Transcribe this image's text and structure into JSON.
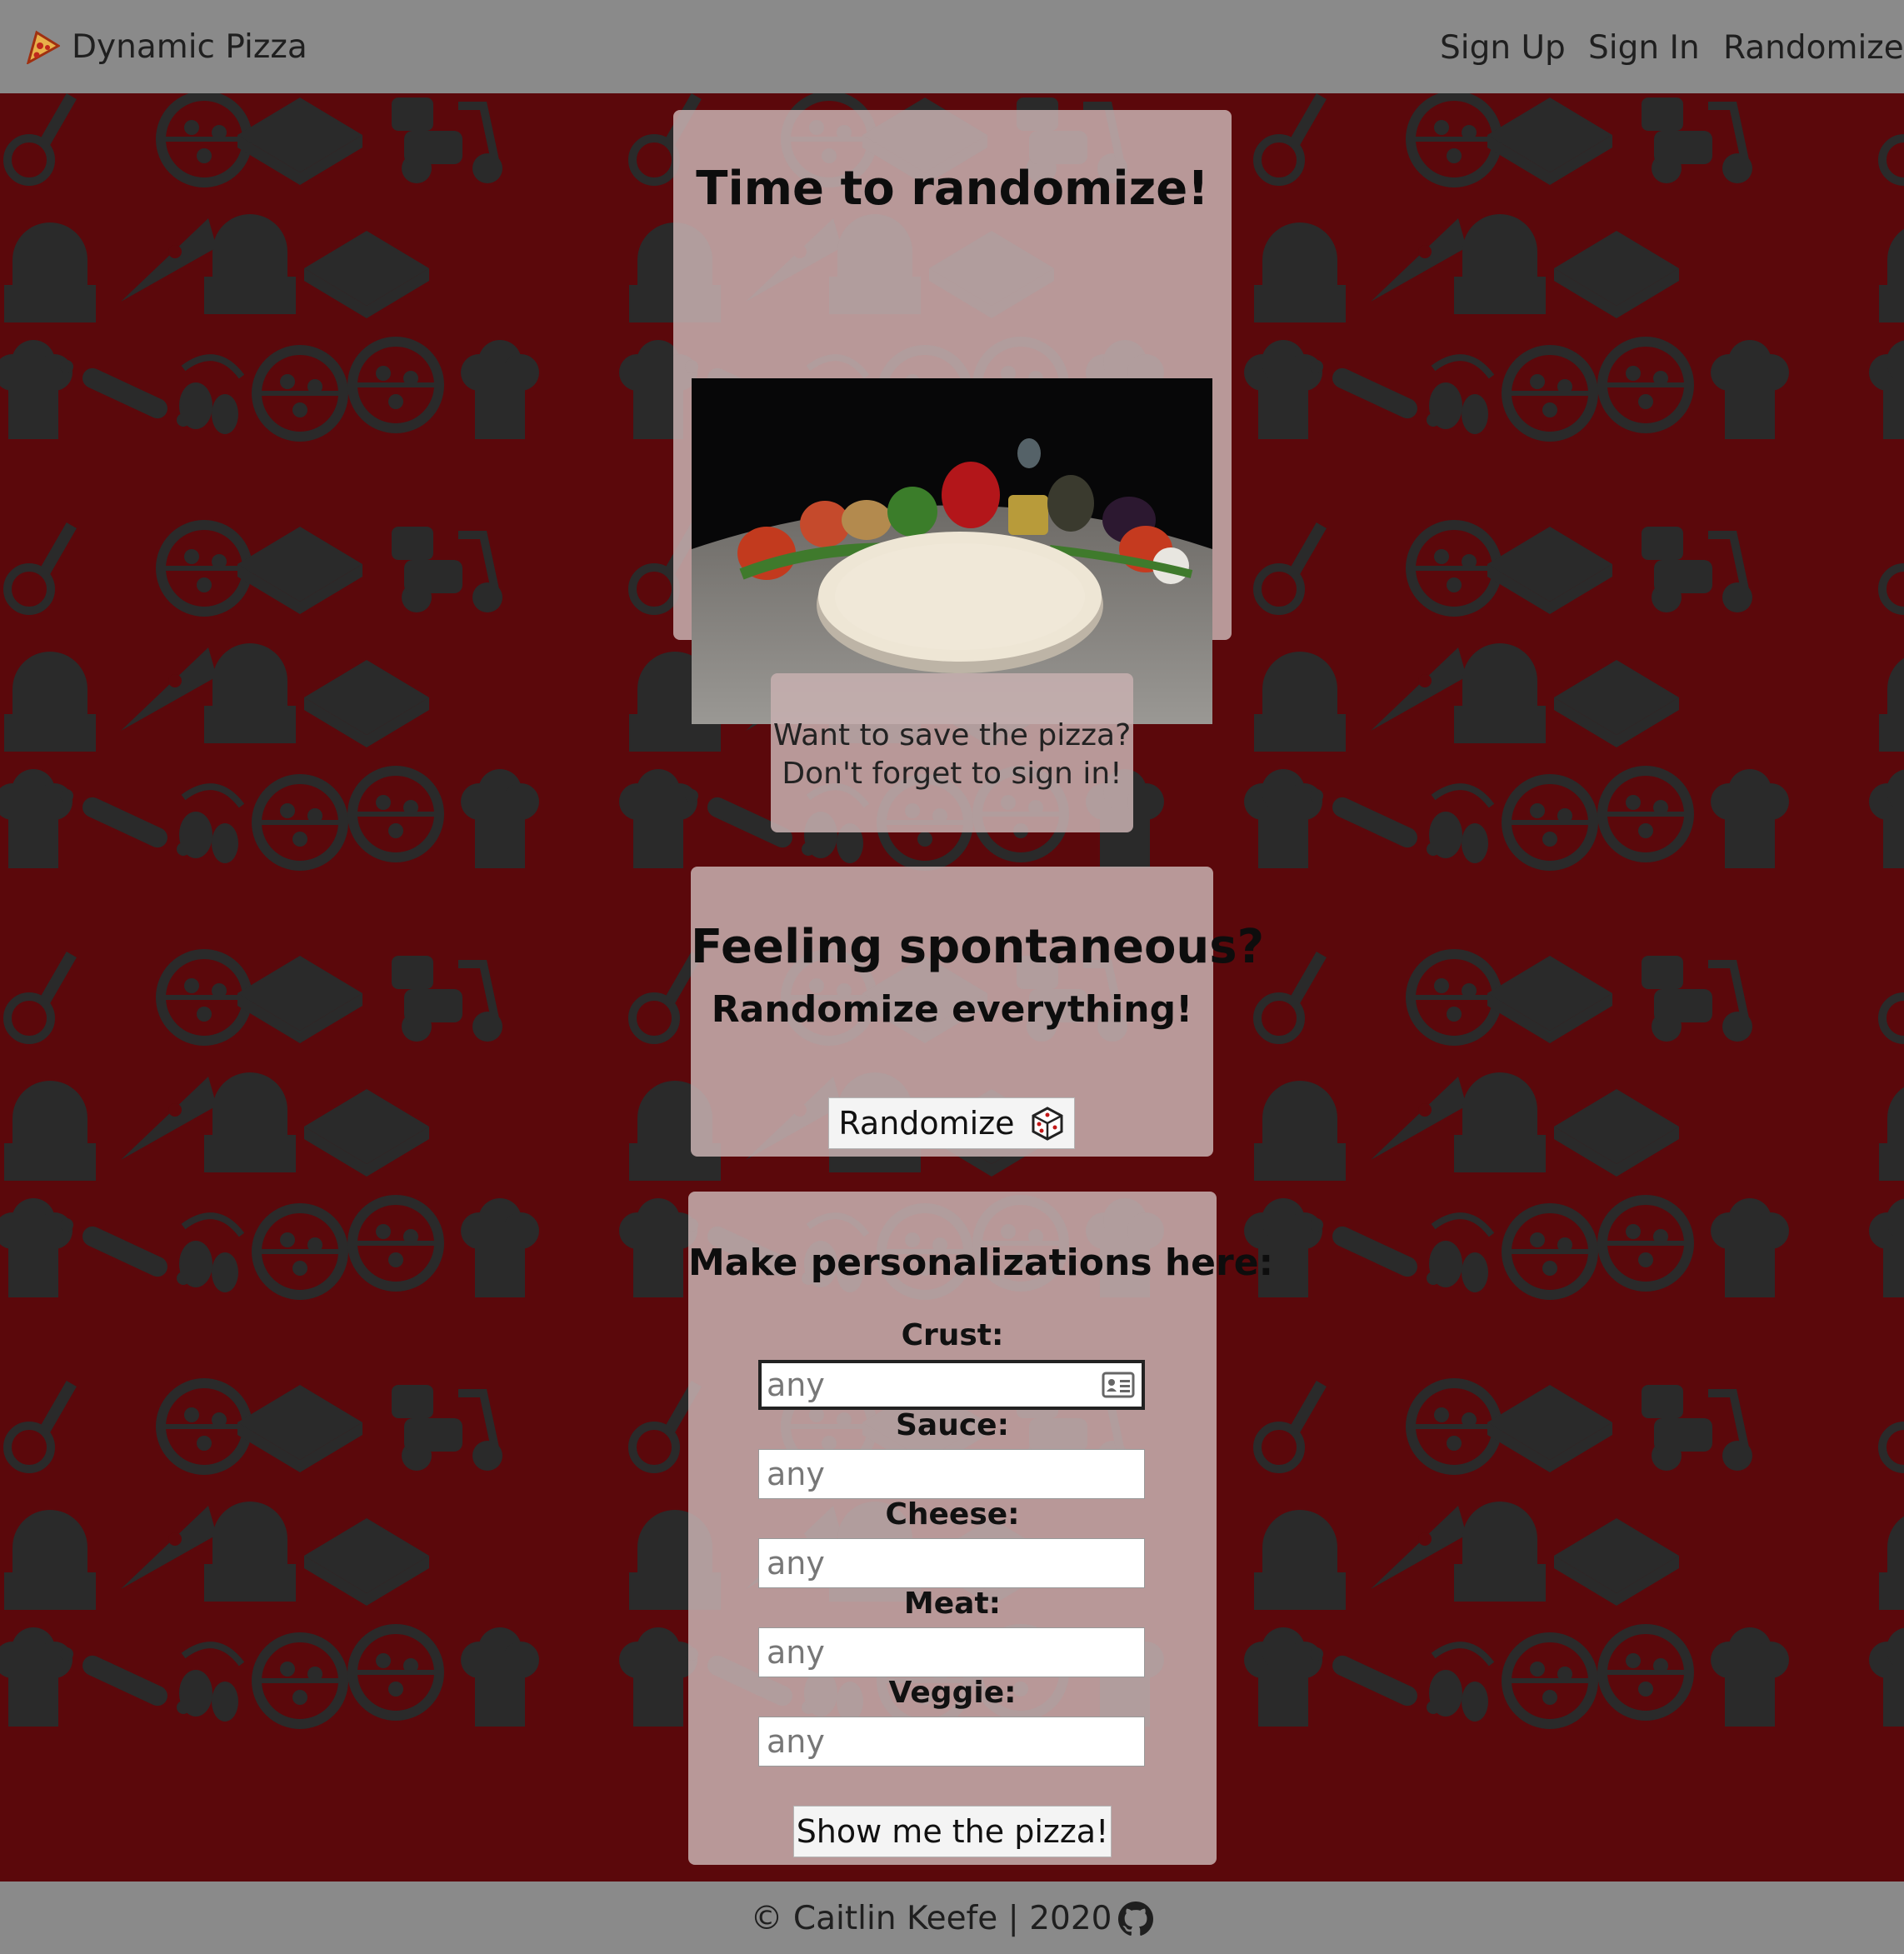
{
  "navbar": {
    "brand": "Dynamic Pizza",
    "brand_icon": "pizza-slice-icon",
    "links": [
      "Sign Up",
      "Sign In",
      "Randomize"
    ]
  },
  "hero": {
    "title": "Time to randomize!",
    "image_alt": "pizza ingredients"
  },
  "note": {
    "line1": "Want to save the pizza?",
    "line2": "Don't forget to sign in!"
  },
  "spontaneous": {
    "title": "Feeling spontaneous?",
    "subtitle": "Randomize everything!",
    "button_label": "Randomize",
    "button_icon": "dice-icon"
  },
  "form": {
    "title": "Make personalizations here:",
    "fields": [
      {
        "label": "Crust:",
        "placeholder": "any"
      },
      {
        "label": "Sauce:",
        "placeholder": "any"
      },
      {
        "label": "Cheese:",
        "placeholder": "any"
      },
      {
        "label": "Meat:",
        "placeholder": "any"
      },
      {
        "label": "Veggie:",
        "placeholder": "any"
      }
    ],
    "submit_label": "Show me the pizza!"
  },
  "footer": {
    "text": "© Caitlin Keefe | 2020",
    "icon": "github-icon"
  },
  "colors": {
    "background": "#5b080b",
    "bar": "#8a8a8a",
    "card": "#c7b0b0",
    "pattern_icon": "#2a2a2a"
  }
}
